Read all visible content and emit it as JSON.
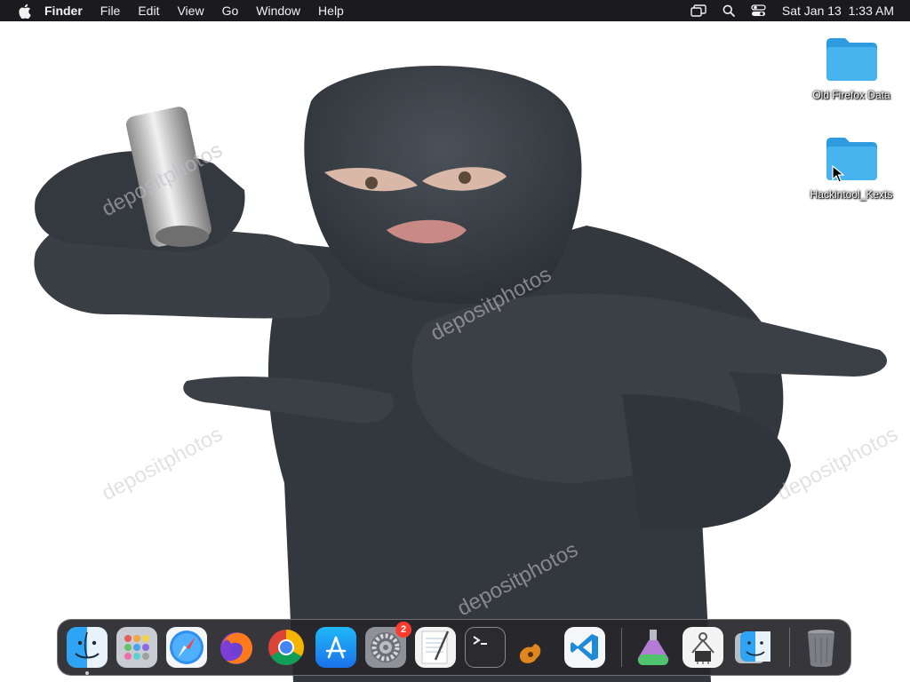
{
  "menubar": {
    "apple_icon": "apple-icon",
    "items": [
      "Finder",
      "File",
      "Edit",
      "View",
      "Go",
      "Window",
      "Help"
    ],
    "status_icons": [
      "screen-mirroring-icon",
      "search-icon",
      "control-center-icon"
    ],
    "datetime": "Sat Jan 13  1:33 AM"
  },
  "wallpaper": {
    "watermark": "depositphotos"
  },
  "desktop_icons": [
    {
      "label": "Old Firefox Data",
      "icon": "folder-icon"
    },
    {
      "label": "Hackintool_Kexts",
      "icon": "folder-icon"
    }
  ],
  "dock": {
    "apps": [
      {
        "name": "finder",
        "icon": "finder-icon",
        "running": true
      },
      {
        "name": "launchpad",
        "icon": "launchpad-icon"
      },
      {
        "name": "safari",
        "icon": "safari-icon"
      },
      {
        "name": "firefox",
        "icon": "firefox-icon"
      },
      {
        "name": "chrome",
        "icon": "chrome-icon"
      },
      {
        "name": "app-store",
        "icon": "app-store-icon"
      },
      {
        "name": "system-preferences",
        "icon": "gear-icon",
        "badge": "2"
      },
      {
        "name": "textedit",
        "icon": "textedit-icon"
      },
      {
        "name": "terminal",
        "icon": "terminal-icon"
      },
      {
        "name": "garageband",
        "icon": "guitar-icon"
      },
      {
        "name": "vscode",
        "icon": "vscode-icon"
      }
    ],
    "extras": [
      {
        "name": "flask-app",
        "icon": "flask-icon"
      },
      {
        "name": "system-information",
        "icon": "chip-icon"
      },
      {
        "name": "finder-recent",
        "icon": "finder-icon"
      }
    ],
    "trash": {
      "name": "trash",
      "icon": "trash-icon"
    }
  },
  "colors": {
    "menubar": "#1b1b1d",
    "folder": "#39a8e8",
    "badge": "#ff3b30"
  }
}
